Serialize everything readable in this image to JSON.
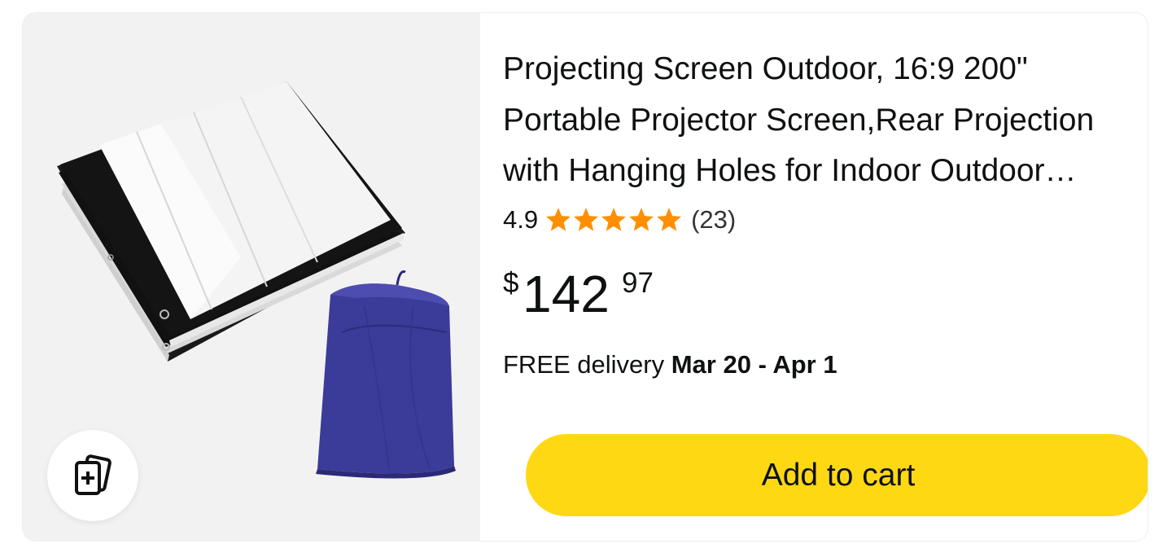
{
  "product": {
    "title": "Projecting Screen Outdoor, 16:9 200\" Portable Projector Screen,Rear Projection with Hanging Holes for Indoor Outdoor Movie",
    "rating": "4.9",
    "rating_stars": 5,
    "review_count": "(23)",
    "price_symbol": "$",
    "price_whole": "142",
    "price_fraction": "97",
    "delivery_prefix": "FREE delivery ",
    "delivery_date": "Mar 20 - Apr 1",
    "add_to_cart_label": "Add to cart",
    "image_icon": "folded-projector-screen-with-storage-bag",
    "compare_icon": "add-to-compare-icon"
  },
  "colors": {
    "star": "#ff8f00",
    "button": "#ffd814",
    "image_bg": "#f2f2f2",
    "bag": "#3b3b99"
  }
}
